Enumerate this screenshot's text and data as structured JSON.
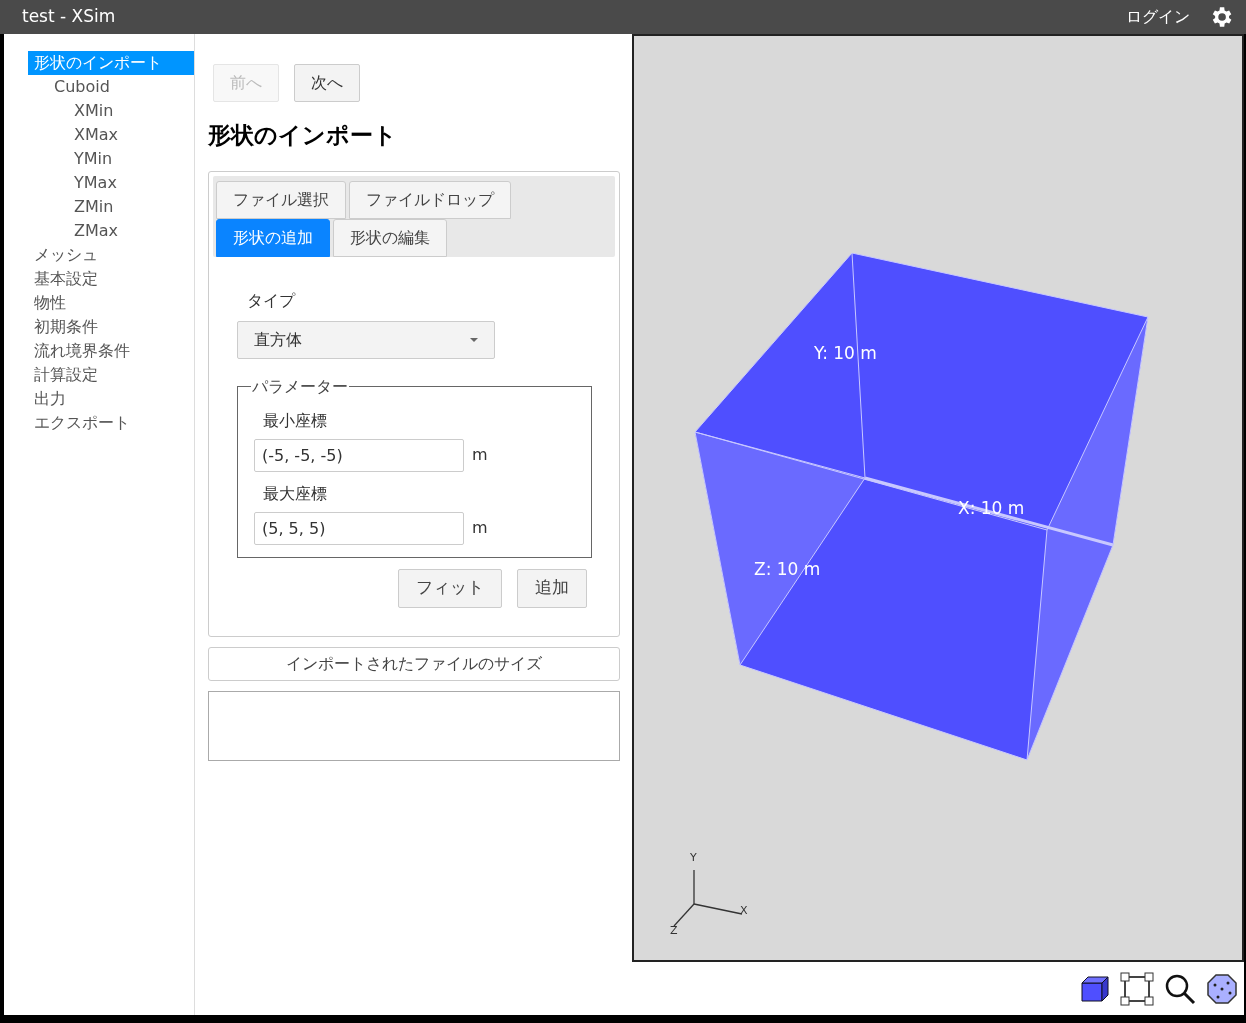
{
  "window": {
    "title": "test - XSim",
    "login": "ログイン"
  },
  "sidebar": {
    "items": [
      {
        "label": "形状のインポート",
        "selected": true,
        "children": [
          {
            "label": "Cuboid",
            "selected": false,
            "children": [
              {
                "label": "XMin",
                "selected": false
              },
              {
                "label": "XMax",
                "selected": false
              },
              {
                "label": "YMin",
                "selected": false
              },
              {
                "label": "YMax",
                "selected": false
              },
              {
                "label": "ZMin",
                "selected": false
              },
              {
                "label": "ZMax",
                "selected": false
              }
            ]
          }
        ]
      },
      {
        "label": "メッシュ",
        "selected": false
      },
      {
        "label": "基本設定",
        "selected": false
      },
      {
        "label": "物性",
        "selected": false
      },
      {
        "label": "初期条件",
        "selected": false
      },
      {
        "label": "流れ境界条件",
        "selected": false
      },
      {
        "label": "計算設定",
        "selected": false
      },
      {
        "label": "出力",
        "selected": false
      },
      {
        "label": "エクスポート",
        "selected": false
      }
    ]
  },
  "nav": [
    {
      "label": "前へ",
      "disabled": true
    },
    {
      "label": "次へ",
      "disabled": false
    }
  ],
  "heading": "形状のインポート",
  "tab_rows": [
    [
      {
        "label": "ファイル選択",
        "selected": false
      },
      {
        "label": "ファイルドロップ",
        "selected": false
      }
    ],
    [
      {
        "label": "形状の追加",
        "selected": true
      },
      {
        "label": "形状の編集",
        "selected": false
      }
    ]
  ],
  "form": {
    "type_label": "タイプ",
    "type_value": "直方体",
    "fieldset": "パラメーター",
    "fields": [
      {
        "label": "最小座標",
        "value": "(-5, -5, -5)",
        "unit": "m"
      },
      {
        "label": "最大座標",
        "value": "(5, 5, 5)",
        "unit": "m"
      }
    ],
    "buttons": [
      "フィット",
      "追加"
    ]
  },
  "file_size": {
    "label": "インポートされたファイルのサイズ"
  },
  "viewport": {
    "labels": [
      "Y: 10 m",
      "X: 10 m",
      "Z: 10 m"
    ],
    "axes": [
      "Y",
      "X",
      "Z"
    ]
  }
}
